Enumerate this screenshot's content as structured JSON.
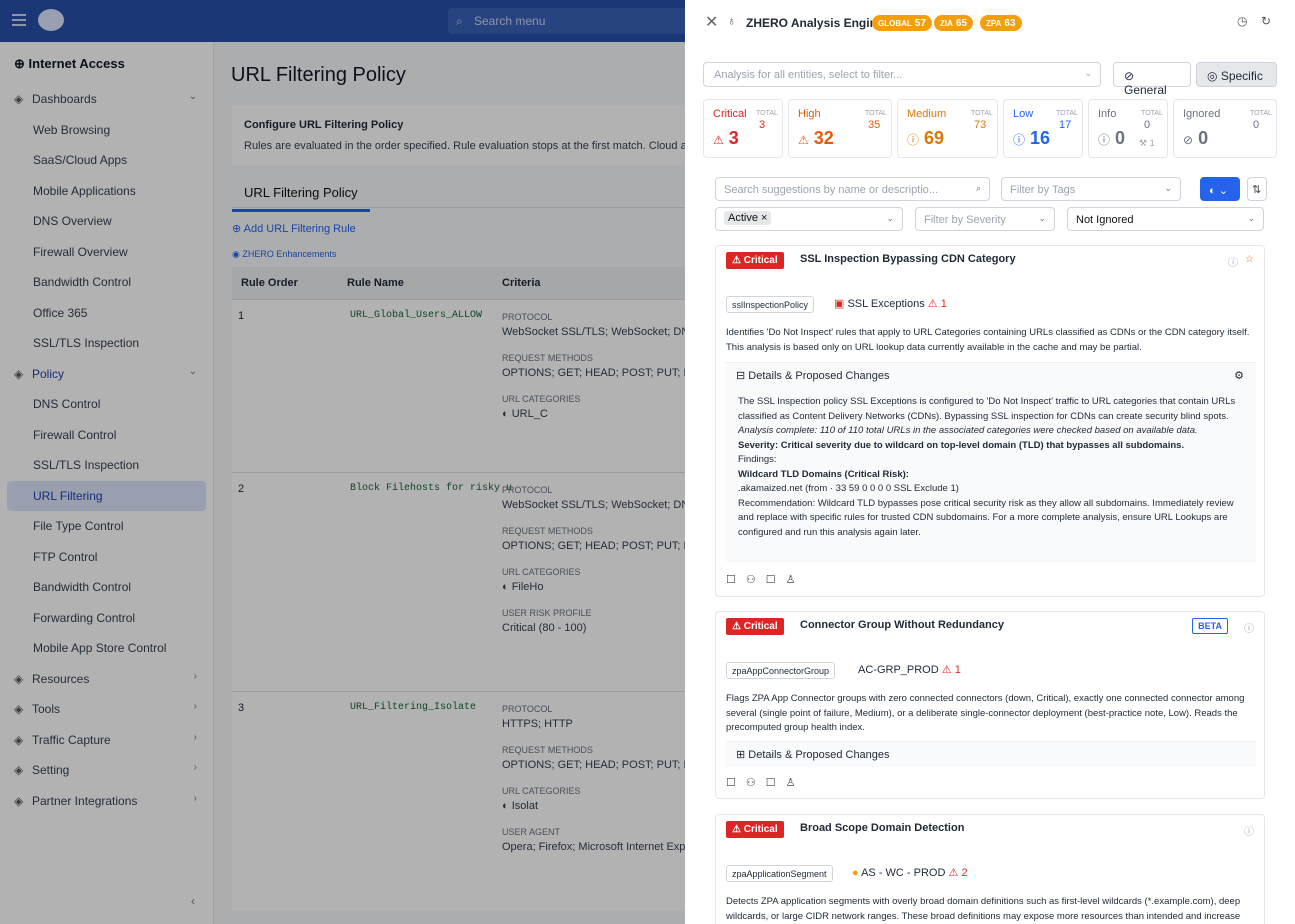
{
  "topbar": {
    "search_placeholder": "Search menu"
  },
  "sidebar": {
    "title": "Internet Access",
    "items": [
      {
        "label": "Dashboards",
        "top": true,
        "icon": "dashboard-icon",
        "chev": "⌄"
      },
      {
        "label": "Web Browsing"
      },
      {
        "label": "SaaS/Cloud Apps"
      },
      {
        "label": "Mobile Applications"
      },
      {
        "label": "DNS Overview"
      },
      {
        "label": "Firewall Overview"
      },
      {
        "label": "Bandwidth Control"
      },
      {
        "label": "Office 365"
      },
      {
        "label": "SSL/TLS Inspection"
      },
      {
        "label": "Policy",
        "top": true,
        "blue": true,
        "icon": "policy-icon",
        "chev": "⌄"
      },
      {
        "label": "DNS Control"
      },
      {
        "label": "Firewall Control"
      },
      {
        "label": "SSL/TLS Inspection"
      },
      {
        "label": "URL Filtering",
        "active": true
      },
      {
        "label": "File Type Control"
      },
      {
        "label": "FTP Control"
      },
      {
        "label": "Bandwidth Control"
      },
      {
        "label": "Forwarding Control"
      },
      {
        "label": "Mobile App Store Control"
      },
      {
        "label": "Resources",
        "top": true,
        "icon": "resources-icon",
        "chev": "›"
      },
      {
        "label": "Tools",
        "top": true,
        "icon": "tools-icon",
        "chev": "›"
      },
      {
        "label": "Traffic Capture",
        "top": true,
        "icon": "traffic-icon",
        "chev": "›"
      },
      {
        "label": "Setting",
        "top": true,
        "icon": "setting-icon",
        "chev": "›"
      },
      {
        "label": "Partner Integrations",
        "top": true,
        "icon": "partner-icon",
        "chev": "›"
      }
    ]
  },
  "main": {
    "title": "URL Filtering Policy",
    "config_title": "Configure URL Filtering Policy",
    "config_text": "Rules are evaluated in the order specified. Rule evaluation stops at the first match. Cloud app c",
    "tab": "URL Filtering Policy",
    "add_rule": "Add URL Filtering Rule",
    "enhancements": "ZHERO Enhancements",
    "columns": [
      "Rule Order",
      "Rule Name",
      "Criteria"
    ],
    "rows": [
      {
        "order": "1",
        "name": "URL_Global_Users_ALLOW",
        "protocol_label": "PROTOCOL",
        "protocol": "WebSocket SSL/TLS; WebSocket; DNS",
        "methods_label": "REQUEST METHODS",
        "methods": "OPTIONS; GET; HEAD; POST; PUT; DEL",
        "cat_label": "URL CATEGORIES",
        "cat": "URL_C"
      },
      {
        "order": "2",
        "name": "Block Filehosts for risky u",
        "protocol_label": "PROTOCOL",
        "protocol": "WebSocket SSL/TLS; WebSocket; DNS",
        "methods_label": "REQUEST METHODS",
        "methods": "OPTIONS; GET; HEAD; POST; PUT; DEL",
        "cat_label": "URL CATEGORIES",
        "cat": "FileHo",
        "risk_label": "USER RISK PROFILE",
        "risk": "Critical (80 - 100)"
      },
      {
        "order": "3",
        "name": "URL_Filtering_Isolate",
        "protocol_label": "PROTOCOL",
        "protocol": "HTTPS; HTTP",
        "methods_label": "REQUEST METHODS",
        "methods": "OPTIONS; GET; HEAD; POST; PUT; DEL",
        "cat_label": "URL CATEGORIES",
        "cat": "Isolat",
        "agent_label": "USER AGENT",
        "agent": "Opera; Firefox; Microsoft Internet Explo"
      }
    ]
  },
  "panel": {
    "title": "ZHERO Analysis Engine",
    "badges": [
      {
        "label": "GLOBAL",
        "value": "57"
      },
      {
        "label": "ZIA",
        "value": "65"
      },
      {
        "label": "ZPA",
        "value": "63"
      }
    ],
    "filter_placeholder": "Analysis for all entities, select to filter...",
    "general": "General",
    "specific": "Specific",
    "severity": [
      {
        "label": "Critical",
        "value": "3",
        "total": "3",
        "color": "#dc2626"
      },
      {
        "label": "High",
        "value": "32",
        "total": "35",
        "color": "#ea580c"
      },
      {
        "label": "Medium",
        "value": "69",
        "total": "73",
        "color": "#d97706"
      },
      {
        "label": "Low",
        "value": "16",
        "total": "17",
        "color": "#2563eb"
      },
      {
        "label": "Info",
        "value": "0",
        "total": "0",
        "extra": "1",
        "color": "#6b7280"
      },
      {
        "label": "Ignored",
        "value": "0",
        "total": "0",
        "color": "#6b7280"
      }
    ],
    "total_label": "TOTAL",
    "search_placeholder": "Search suggestions by name or descriptio...",
    "tags_placeholder": "Filter by Tags",
    "active_chip": "Active",
    "severity_placeholder": "Filter by Severity",
    "ignored_filter": "Not Ignored",
    "cards": [
      {
        "severity": "Critical",
        "title": "SSL Inspection Bypassing CDN Category",
        "tag": "sslInspectionPolicy",
        "entity": "SSL Exceptions",
        "count": "1",
        "desc": "Identifies 'Do Not Inspect' rules that apply to URL Categories containing URLs classified as CDNs or the CDN category itself. This analysis is based only on URL lookup data currently available in the cache and may be partial.",
        "details": "Details & Proposed Changes",
        "body": [
          "The SSL Inspection policy SSL Exceptions is configured to 'Do Not Inspect' traffic to URL categories that contain URLs classified as Content Delivery Networks (CDNs). Bypassing SSL inspection for CDNs can create security blind spots.",
          "Analysis complete: 110 of 110 total URLs in the associated categories were checked based on available data.",
          "Severity: Critical severity due to wildcard on top-level domain (TLD) that bypasses all subdomains.",
          "Findings:",
          "Wildcard TLD Domains (Critical Risk):",
          ".akamaized.net (from  ·  33  59  0  0  0  0   SSL Exclude  1)",
          "Recommendation: Wildcard TLD bypasses pose critical security risk as they allow all subdomains. Immediately review and replace with specific rules for trusted CDN subdomains. For a more complete analysis, ensure URL Lookups are configured and run this analysis again later."
        ]
      },
      {
        "severity": "Critical",
        "title": "Connector Group Without Redundancy",
        "beta": "BETA",
        "tag": "zpaAppConnectorGroup",
        "entity": "AC-GRP_PROD",
        "count": "1",
        "desc": "Flags ZPA App Connector groups with zero connected connectors (down, Critical), exactly one connected connector among several (single point of failure, Medium), or a deliberate single-connector deployment (best-practice note, Low). Reads the precomputed group health index.",
        "details": "Details & Proposed Changes"
      },
      {
        "severity": "Critical",
        "title": "Broad Scope Domain Detection",
        "tag": "zpaApplicationSegment",
        "entity": "AS - WC - PROD",
        "count": "2",
        "desc": "Detects ZPA application segments with overly broad domain definitions such as first-level wildcards (*.example.com), deep wildcards, or large CIDR network ranges. These broad definitions may expose more resources than intended and increase"
      }
    ]
  }
}
